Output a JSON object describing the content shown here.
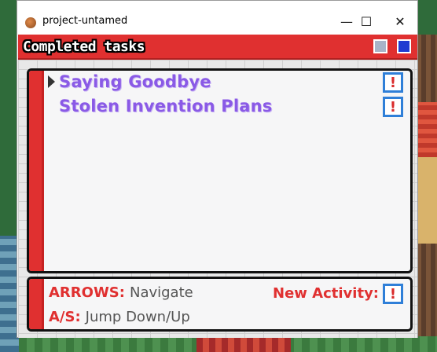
{
  "window": {
    "title": "project-untamed",
    "controls": {
      "minimize": "—",
      "maximize": "☐",
      "close": "✕"
    }
  },
  "panel": {
    "title": "Completed tasks",
    "tasks": [
      {
        "label": "Saying Goodbye",
        "badge": "!",
        "selected": true
      },
      {
        "label": "Stolen Invention Plans",
        "badge": "!",
        "selected": false
      }
    ],
    "help": {
      "arrows_key": "ARROWS:",
      "arrows_text": "Navigate",
      "as_key": "A/S:",
      "as_text": "Jump Down/Up",
      "new_activity": "New Activity:",
      "new_activity_badge": "!"
    }
  },
  "colors": {
    "header_red": "#e03030",
    "task_purple": "#8a5ae6",
    "badge_blue": "#2f7fd8",
    "badge_red": "#d92b2b"
  }
}
